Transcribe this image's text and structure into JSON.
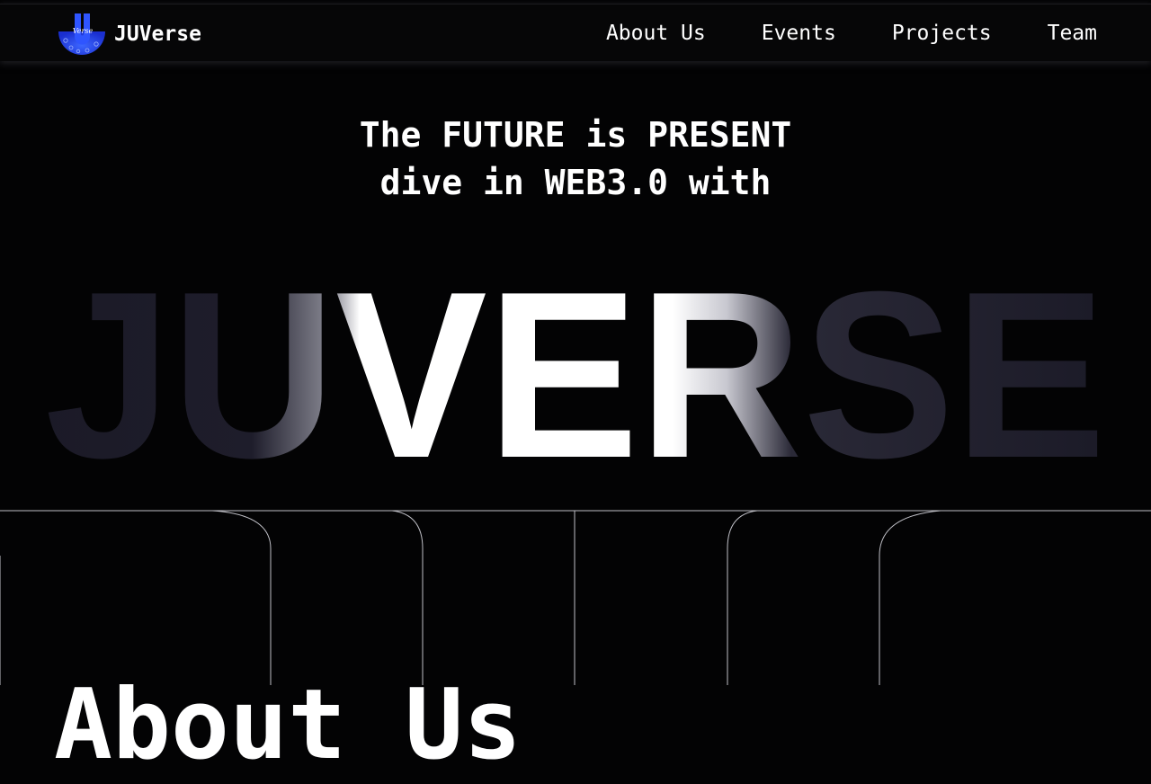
{
  "header": {
    "logo_icon": "juverse-u-logo-icon",
    "logo_text": "Verse",
    "brand": "JUVerse",
    "nav": [
      {
        "label": "About Us"
      },
      {
        "label": "Events"
      },
      {
        "label": "Projects"
      },
      {
        "label": "Team"
      }
    ]
  },
  "hero": {
    "line1": "The FUTURE is PRESENT",
    "line2": "dive in WEB3.0 with",
    "big_word": "JUVERSE"
  },
  "about": {
    "heading": "About Us"
  },
  "colors": {
    "background": "#030304",
    "text": "#ffffff",
    "dim_letters": "#1b1a27",
    "logo_blue": "#2b4bf0"
  }
}
